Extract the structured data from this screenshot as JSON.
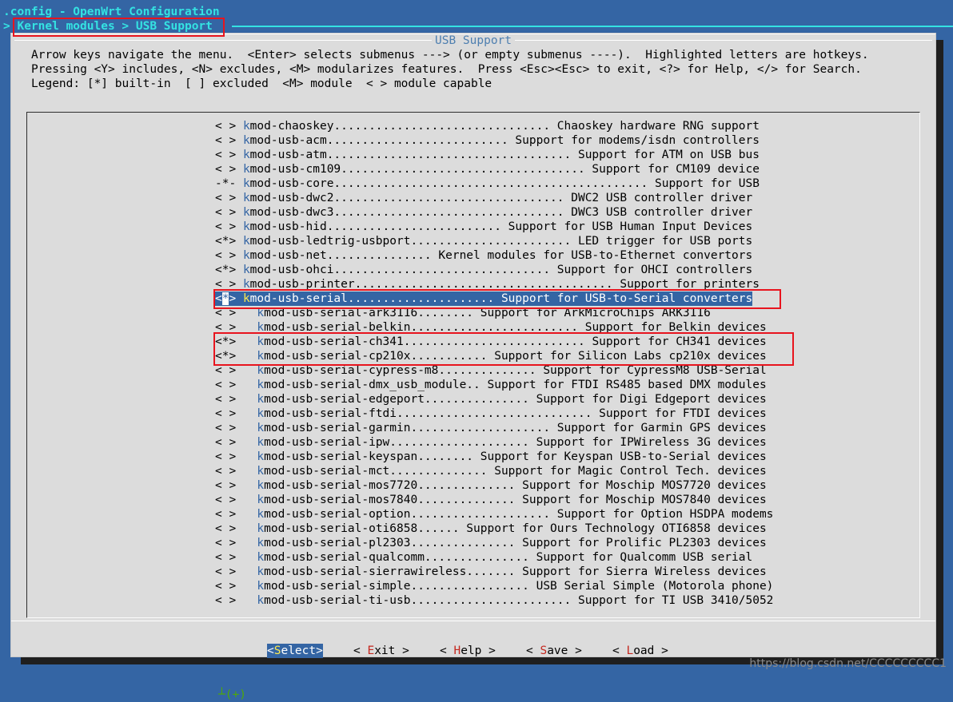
{
  "title_bar": ".config - OpenWrt Configuration",
  "breadcrumb": "> Kernel modules > USB Support",
  "dialog": {
    "title": "USB Support",
    "help_lines": [
      "Arrow keys navigate the menu.  <Enter> selects submenus ---> (or empty submenus ----).  Highlighted letters are hotkeys.",
      "Pressing <Y> includes, <N> excludes, <M> modularizes features.  Press <Esc><Esc> to exit, <?> for Help, </> for Search.",
      "Legend: [*] built-in  [ ] excluded  <M> module  < > module capable"
    ]
  },
  "menu": {
    "items": [
      {
        "state": "< >",
        "name": "kmod-chaoskey",
        "desc": "Chaoskey hardware RNG support",
        "indent": 0,
        "dots": 31
      },
      {
        "state": "< >",
        "name": "kmod-usb-acm",
        "desc": "Support for modems/isdn controllers",
        "indent": 0,
        "dots": 26
      },
      {
        "state": "< >",
        "name": "kmod-usb-atm",
        "desc": "Support for ATM on USB bus",
        "indent": 0,
        "dots": 35
      },
      {
        "state": "< >",
        "name": "kmod-usb-cm109",
        "desc": "Support for CM109 device",
        "indent": 0,
        "dots": 35
      },
      {
        "state": "-*-",
        "name": "kmod-usb-core",
        "desc": "Support for USB",
        "indent": 0,
        "dots": 45
      },
      {
        "state": "< >",
        "name": "kmod-usb-dwc2",
        "desc": "DWC2 USB controller driver",
        "indent": 0,
        "dots": 33
      },
      {
        "state": "< >",
        "name": "kmod-usb-dwc3",
        "desc": "DWC3 USB controller driver",
        "indent": 0,
        "dots": 33
      },
      {
        "state": "< >",
        "name": "kmod-usb-hid",
        "desc": "Support for USB Human Input Devices",
        "indent": 0,
        "dots": 25
      },
      {
        "state": "<*>",
        "name": "kmod-usb-ledtrig-usbport",
        "desc": "LED trigger for USB ports",
        "indent": 0,
        "dots": 23
      },
      {
        "state": "< >",
        "name": "kmod-usb-net",
        "desc": "Kernel modules for USB-to-Ethernet convertors",
        "indent": 0,
        "dots": 15
      },
      {
        "state": "<*>",
        "name": "kmod-usb-ohci",
        "desc": "Support for OHCI controllers",
        "indent": 0,
        "dots": 31
      },
      {
        "state": "< >",
        "name": "kmod-usb-printer",
        "desc": "Support for printers",
        "indent": 0,
        "dots": 37
      },
      {
        "state": "<*>",
        "name": "kmod-usb-serial",
        "desc": "Support for USB-to-Serial converters",
        "indent": 0,
        "dots": 21,
        "selected": true
      },
      {
        "state": "< >",
        "name": "kmod-usb-serial-ark3116",
        "desc": "Support for ArkMicroChips ARK3116",
        "indent": 2,
        "dots": 8
      },
      {
        "state": "< >",
        "name": "kmod-usb-serial-belkin",
        "desc": "Support for Belkin devices",
        "indent": 2,
        "dots": 24
      },
      {
        "state": "<*>",
        "name": "kmod-usb-serial-ch341",
        "desc": "Support for CH341 devices",
        "indent": 2,
        "dots": 26
      },
      {
        "state": "<*>",
        "name": "kmod-usb-serial-cp210x",
        "desc": "Support for Silicon Labs cp210x devices",
        "indent": 2,
        "dots": 11
      },
      {
        "state": "< >",
        "name": "kmod-usb-serial-cypress-m8",
        "desc": "Support for CypressM8 USB-Serial",
        "indent": 2,
        "dots": 14
      },
      {
        "state": "< >",
        "name": "kmod-usb-serial-dmx_usb_module",
        "desc": "Support for FTDI RS485 based DMX modules",
        "indent": 2,
        "dots": 2
      },
      {
        "state": "< >",
        "name": "kmod-usb-serial-edgeport",
        "desc": "Support for Digi Edgeport devices",
        "indent": 2,
        "dots": 15
      },
      {
        "state": "< >",
        "name": "kmod-usb-serial-ftdi",
        "desc": "Support for FTDI devices",
        "indent": 2,
        "dots": 28
      },
      {
        "state": "< >",
        "name": "kmod-usb-serial-garmin",
        "desc": "Support for Garmin GPS devices",
        "indent": 2,
        "dots": 20
      },
      {
        "state": "< >",
        "name": "kmod-usb-serial-ipw",
        "desc": "Support for IPWireless 3G devices",
        "indent": 2,
        "dots": 20
      },
      {
        "state": "< >",
        "name": "kmod-usb-serial-keyspan",
        "desc": "Support for Keyspan USB-to-Serial devices",
        "indent": 2,
        "dots": 8
      },
      {
        "state": "< >",
        "name": "kmod-usb-serial-mct",
        "desc": "Support for Magic Control Tech. devices",
        "indent": 2,
        "dots": 14
      },
      {
        "state": "< >",
        "name": "kmod-usb-serial-mos7720",
        "desc": "Support for Moschip MOS7720 devices",
        "indent": 2,
        "dots": 14
      },
      {
        "state": "< >",
        "name": "kmod-usb-serial-mos7840",
        "desc": "Support for Moschip MOS7840 devices",
        "indent": 2,
        "dots": 14
      },
      {
        "state": "< >",
        "name": "kmod-usb-serial-option",
        "desc": "Support for Option HSDPA modems",
        "indent": 2,
        "dots": 20
      },
      {
        "state": "< >",
        "name": "kmod-usb-serial-oti6858",
        "desc": "Support for Ours Technology OTI6858 devices",
        "indent": 2,
        "dots": 6
      },
      {
        "state": "< >",
        "name": "kmod-usb-serial-pl2303",
        "desc": "Support for Prolific PL2303 devices",
        "indent": 2,
        "dots": 15
      },
      {
        "state": "< >",
        "name": "kmod-usb-serial-qualcomm",
        "desc": "Support for Qualcomm USB serial",
        "indent": 2,
        "dots": 15
      },
      {
        "state": "< >",
        "name": "kmod-usb-serial-sierrawireless",
        "desc": "Support for Sierra Wireless devices",
        "indent": 2,
        "dots": 7
      },
      {
        "state": "< >",
        "name": "kmod-usb-serial-simple",
        "desc": "USB Serial Simple (Motorola phone)",
        "indent": 2,
        "dots": 17
      },
      {
        "state": "< >",
        "name": "kmod-usb-serial-ti-usb",
        "desc": "Support for TI USB 3410/5052",
        "indent": 2,
        "dots": 23
      }
    ],
    "more_indicator": "┴(+)"
  },
  "buttons": [
    {
      "label": "Select",
      "hotkey_index": 0,
      "active": true
    },
    {
      "label": "Exit",
      "hotkey_index": 0,
      "active": false
    },
    {
      "label": "Help",
      "hotkey_index": 0,
      "active": false
    },
    {
      "label": "Save",
      "hotkey_index": 0,
      "active": false
    },
    {
      "label": "Load",
      "hotkey_index": 0,
      "active": false
    }
  ],
  "watermark": "https://blog.csdn.net/CCCCCCCCC1",
  "colors": {
    "background": "#3465a4",
    "dialog": "#dcdcdc",
    "highlight": "#3465a4",
    "hotkey": "#c4281f",
    "annotation": "#e8141e"
  }
}
